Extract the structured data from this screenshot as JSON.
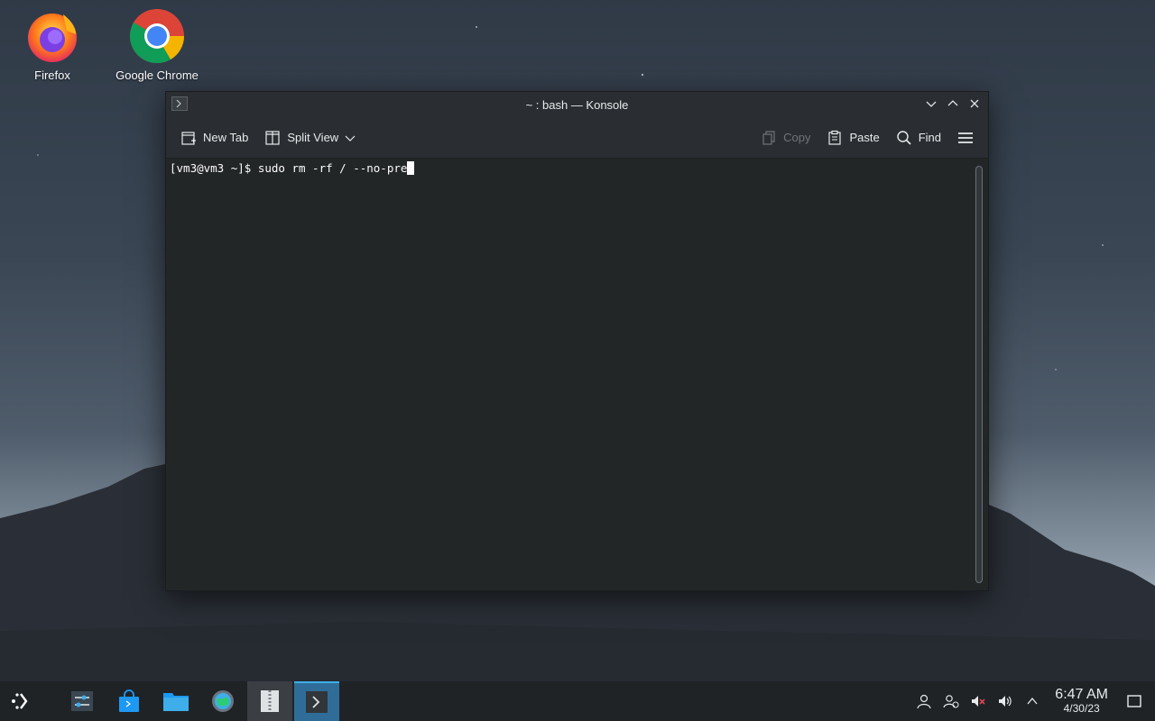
{
  "desktop": {
    "icons": [
      {
        "label": "Firefox"
      },
      {
        "label": "Google Chrome"
      }
    ]
  },
  "window": {
    "title": "~ : bash — Konsole",
    "toolbar": {
      "new_tab": "New Tab",
      "split_view": "Split View",
      "copy": "Copy",
      "paste": "Paste",
      "find": "Find"
    },
    "terminal": {
      "prompt": "[vm3@vm3 ~]$ ",
      "command": "sudo rm -rf / --no-pre"
    }
  },
  "taskbar": {
    "clock": {
      "time": "6:47 AM",
      "date": "4/30/23"
    }
  },
  "colors": {
    "accent": "#3daee9",
    "terminal_bg": "#232627",
    "titlebar_bg": "#2a2e32",
    "taskbar_bg": "#1f2326"
  }
}
